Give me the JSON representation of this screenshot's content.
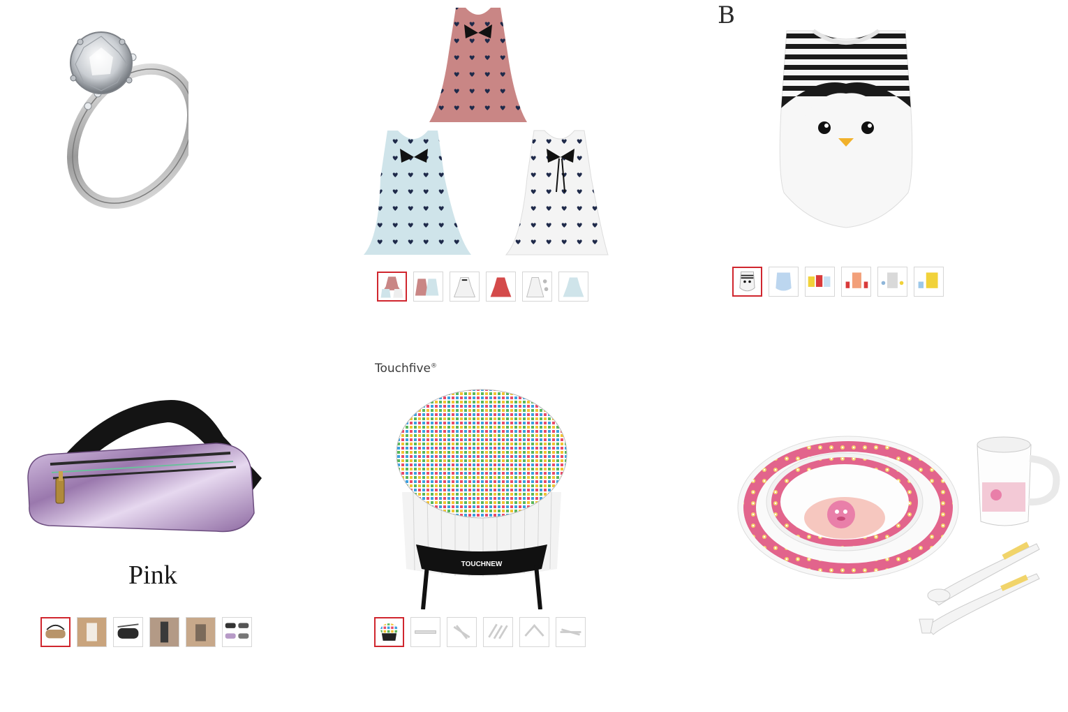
{
  "products": {
    "ring": {
      "icon": "diamond-ring-image"
    },
    "dresses": {
      "icon": "three-girls-dresses-image",
      "thumbnail_count": 6,
      "selected_thumbnail": 1
    },
    "romper": {
      "overlay_letter": "B",
      "icon": "penguin-romper-image",
      "thumbnail_count": 6,
      "selected_thumbnail": 1
    },
    "fanny_pack": {
      "color_label": "Pink",
      "icon": "pink-fanny-pack-image",
      "thumbnail_count": 6,
      "selected_thumbnail": 0
    },
    "markers": {
      "brand": "Touchfive",
      "brand_mark": "®",
      "bag_text": "TOUCHNEW",
      "icon": "marker-set-image",
      "thumbnail_count": 6,
      "selected_thumbnail": 1
    },
    "tableware": {
      "icon": "kids-tableware-set-image"
    }
  },
  "colors": {
    "selected_border": "#d0262e",
    "thumb_border": "#d6d6d6",
    "dress_pink": "#c98685",
    "dress_blue": "#cfe4ea",
    "pack_purple": "#b79ac7",
    "plate_pink": "#e2648c"
  }
}
